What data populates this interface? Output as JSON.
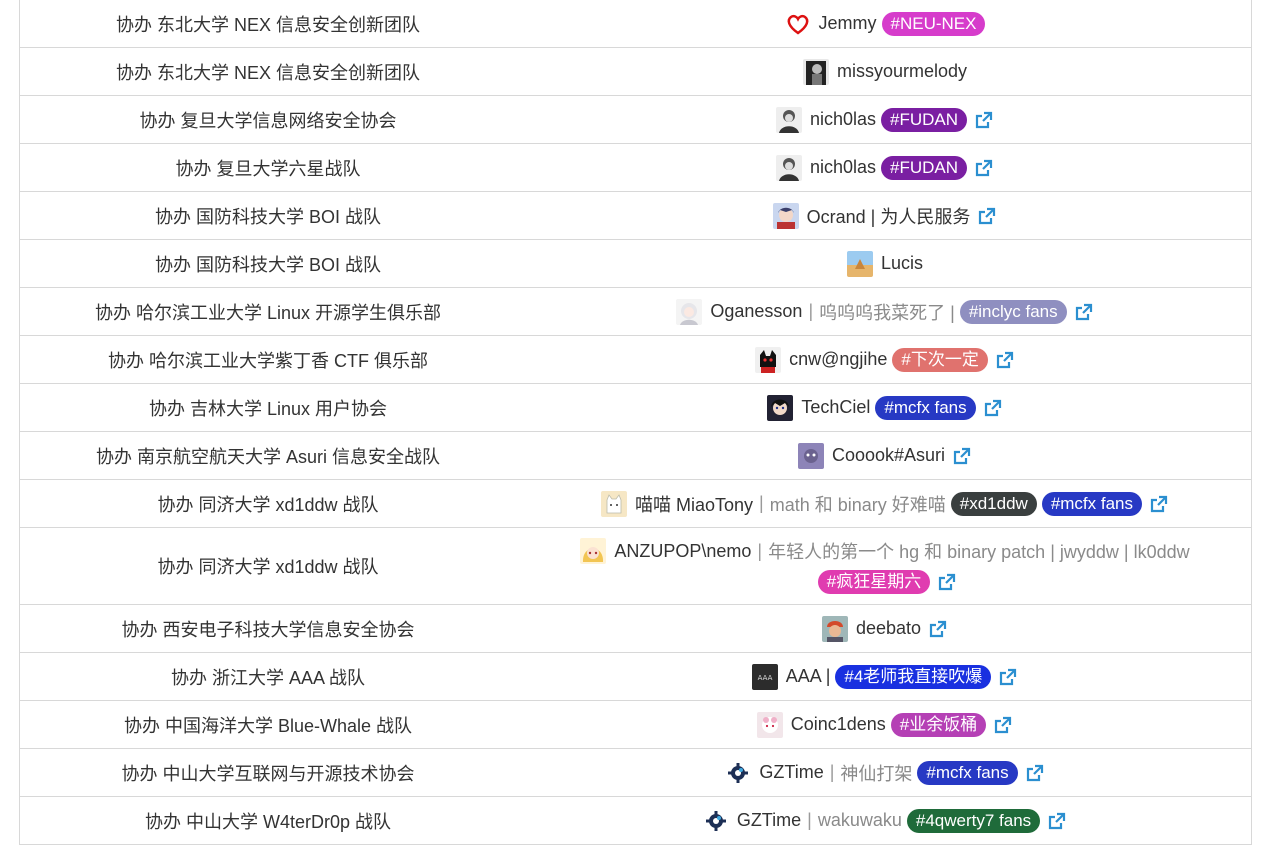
{
  "rows": [
    {
      "team": "协办 东北大学 NEX 信息安全创新团队",
      "avatar": "heart-avatar",
      "name": "Jemmy",
      "note": "",
      "tags": [
        {
          "label": "#NEU-NEX",
          "color": "#d63ccb"
        }
      ],
      "ext": false
    },
    {
      "team": "协办 东北大学 NEX 信息安全创新团队",
      "avatar": "bw-portrait-avatar",
      "name": "missyourmelody",
      "note": "",
      "tags": [],
      "ext": false
    },
    {
      "team": "协办 复旦大学信息网络安全协会",
      "avatar": "sketch-portrait-avatar",
      "name": "nich0las",
      "note": "",
      "tags": [
        {
          "label": "#FUDAN",
          "color": "#7a1fa2"
        }
      ],
      "ext": true
    },
    {
      "team": "协办 复旦大学六星战队",
      "avatar": "sketch-portrait-avatar",
      "name": "nich0las",
      "note": "",
      "tags": [
        {
          "label": "#FUDAN",
          "color": "#7a1fa2"
        }
      ],
      "ext": true
    },
    {
      "team": "协办 国防科技大学 BOI 战队",
      "avatar": "anime-avatar",
      "name": "Ocrand | 为人民服务",
      "note": "",
      "tags": [],
      "ext": true
    },
    {
      "team": "协办 国防科技大学 BOI 战队",
      "avatar": "desert-avatar",
      "name": "Lucis",
      "note": "",
      "tags": [],
      "ext": false
    },
    {
      "team": "协办 哈尔滨工业大学 Linux 开源学生俱乐部",
      "avatar": "white-hair-avatar",
      "name": "Oganesson",
      "note": "呜呜呜我菜死了 |",
      "tags": [
        {
          "label": "#inclyc fans",
          "color": "#8f8fc0"
        }
      ],
      "ext": true
    },
    {
      "team": "协办 哈尔滨工业大学紫丁香 CTF 俱乐部",
      "avatar": "black-cat-avatar",
      "name": "cnw@ngjihe",
      "note": "",
      "tags": [
        {
          "label": "#下次一定",
          "color": "#e0726e"
        }
      ],
      "ext": true
    },
    {
      "team": "协办 吉林大学 Linux 用户协会",
      "avatar": "dark-anime-avatar",
      "name": "TechCiel",
      "note": "",
      "tags": [
        {
          "label": "#mcfx fans",
          "color": "#2739c4"
        }
      ],
      "ext": true
    },
    {
      "team": "协办 南京航空航天大学 Asuri 信息安全战队",
      "avatar": "purple-avatar",
      "name": "Cooook#Asuri",
      "note": "",
      "tags": [],
      "ext": true
    },
    {
      "team": "协办 同济大学 xd1ddw 战队",
      "avatar": "cute-cat-avatar",
      "name": "喵喵 MiaoTony",
      "note": "math 和 binary 好难喵",
      "tags": [
        {
          "label": "#xd1ddw",
          "color": "#3a3f3f"
        },
        {
          "label": "#mcfx fans",
          "color": "#2739c4"
        }
      ],
      "ext": true
    },
    {
      "team": "协办 同济大学 xd1ddw 战队",
      "avatar": "blonde-anime-avatar",
      "name": "ANZUPOP\\nemo",
      "note": "年轻人的第一个 hg 和 binary patch | jwyddw | lk0ddw",
      "tags": [
        {
          "label": "#疯狂星期六",
          "color": "#e03cb0"
        }
      ],
      "ext": true,
      "tall": true
    },
    {
      "team": "协办 西安电子科技大学信息安全协会",
      "avatar": "red-hat-avatar",
      "name": "deebato",
      "note": "",
      "tags": [],
      "ext": true
    },
    {
      "team": "协办 浙江大学 AAA 战队",
      "avatar": "aaa-logo-avatar",
      "name": "AAA |",
      "note": "",
      "tags": [
        {
          "label": "#4老师我直接吹爆",
          "color": "#1930e0"
        }
      ],
      "ext": true
    },
    {
      "team": "协办 中国海洋大学 Blue-Whale 战队",
      "avatar": "pink-anime-avatar",
      "name": "Coinc1dens",
      "note": "",
      "tags": [
        {
          "label": "#业余饭桶",
          "color": "#b540b5"
        }
      ],
      "ext": true
    },
    {
      "team": "协办 中山大学互联网与开源技术协会",
      "avatar": "gear-logo-avatar",
      "name": "GZTime",
      "note": "神仙打架",
      "tags": [
        {
          "label": "#mcfx fans",
          "color": "#2739c4"
        }
      ],
      "ext": true
    },
    {
      "team": "协办 中山大学 W4terDr0p 战队",
      "avatar": "gear-logo-avatar",
      "name": "GZTime",
      "note": "wakuwaku",
      "tags": [
        {
          "label": "#4qwerty7 fans",
          "color": "#1f6b3a"
        }
      ],
      "ext": true
    }
  ],
  "colors": {
    "border": "#d8d8d8",
    "link_icon": "#2b8fd0",
    "text": "#333333",
    "muted": "#8a8a8a"
  }
}
